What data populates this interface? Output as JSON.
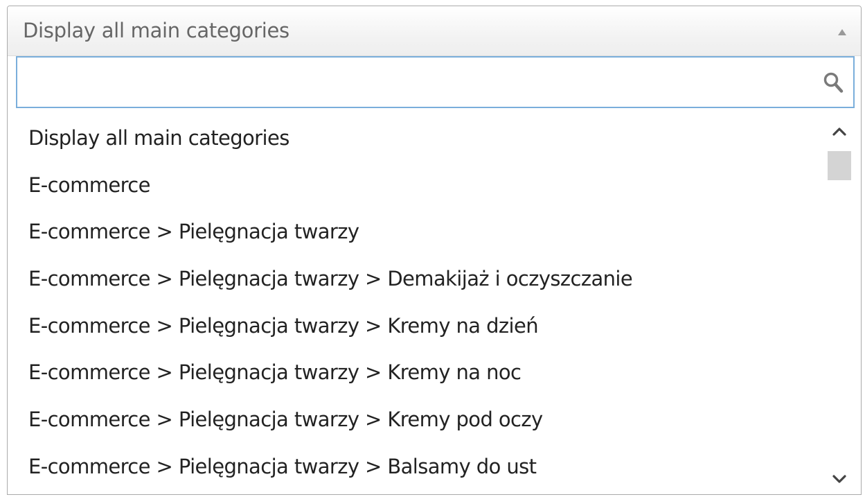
{
  "select": {
    "selected_label": "Display all main categories",
    "arrow_icon": "triangle-up-icon"
  },
  "search": {
    "value": "",
    "placeholder": "",
    "icon": "search-icon"
  },
  "results": {
    "items": [
      {
        "label": "Display all main categories"
      },
      {
        "label": "E-commerce"
      },
      {
        "label": "E-commerce > Pielęgnacja twarzy"
      },
      {
        "label": "E-commerce > Pielęgnacja twarzy > Demakijaż i oczyszczanie"
      },
      {
        "label": "E-commerce > Pielęgnacja twarzy > Kremy na dzień"
      },
      {
        "label": "E-commerce > Pielęgnacja twarzy > Kremy na noc"
      },
      {
        "label": "E-commerce > Pielęgnacja twarzy > Kremy pod oczy"
      },
      {
        "label": "E-commerce > Pielęgnacja twarzy > Balsamy do ust"
      }
    ]
  },
  "scrollbar": {
    "up_icon": "chevron-up-icon",
    "down_icon": "chevron-down-icon",
    "position": 0
  },
  "colors": {
    "focus_border": "#7aaedb",
    "border": "#aaaaaa",
    "thumb": "#d4d4d4"
  }
}
